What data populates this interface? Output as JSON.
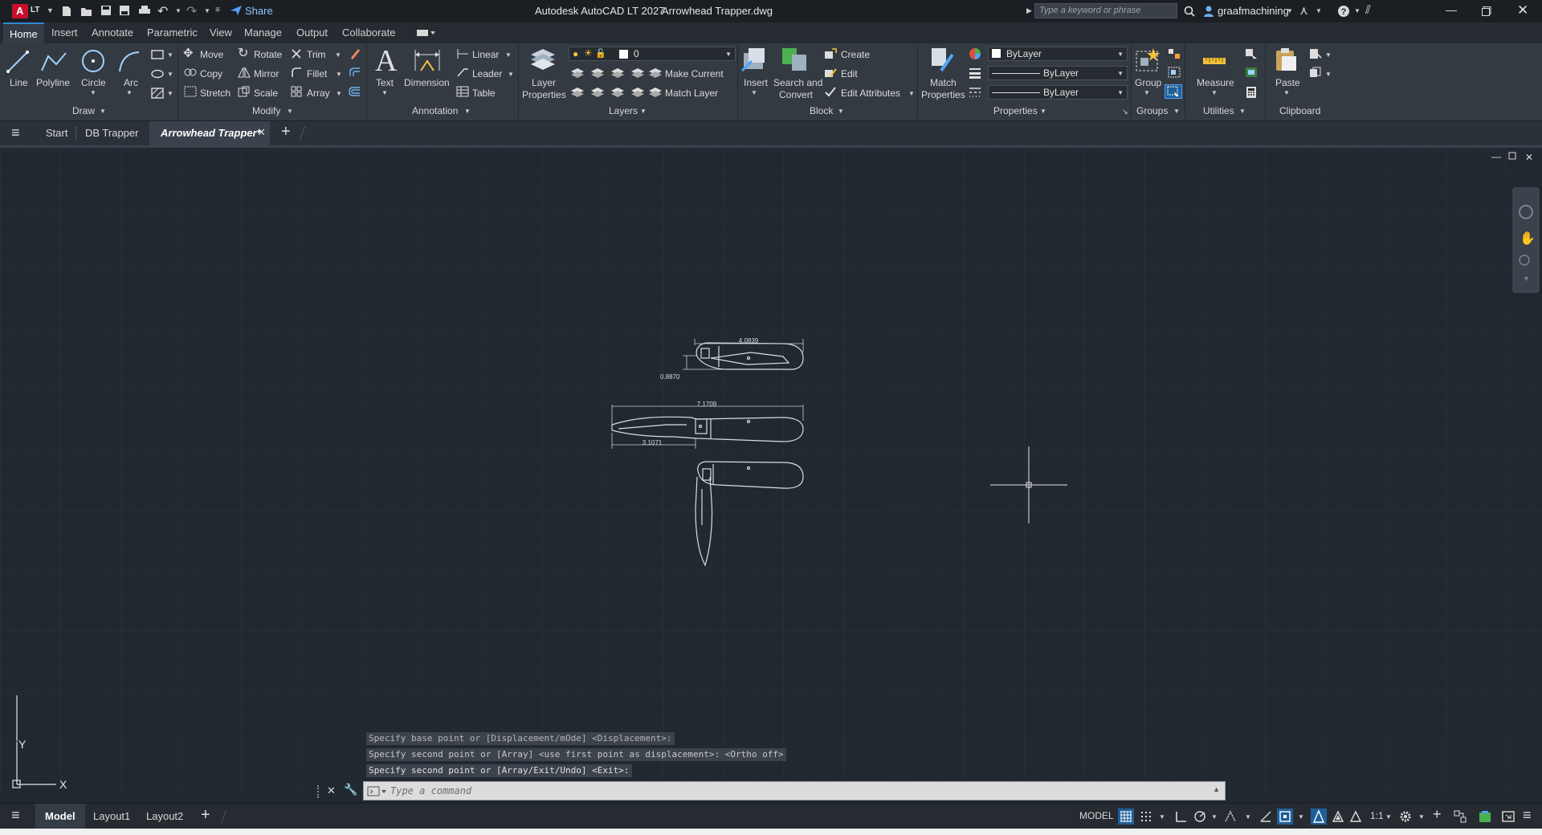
{
  "app": {
    "logo_text": "A",
    "logo_badge": "LT",
    "share_label": "Share",
    "product": "Autodesk AutoCAD LT 2027",
    "filename": "Arrowhead Trapper.dwg",
    "search_placeholder": "Type a keyword or phrase",
    "username": "graafmachining"
  },
  "ribbon_tabs": [
    "Home",
    "Insert",
    "Annotate",
    "Parametric",
    "View",
    "Manage",
    "Output",
    "Collaborate"
  ],
  "draw": {
    "panel": "Draw",
    "line": "Line",
    "polyline": "Polyline",
    "circle": "Circle",
    "arc": "Arc"
  },
  "modify": {
    "panel": "Modify",
    "move": "Move",
    "rotate": "Rotate",
    "trim": "Trim",
    "copy": "Copy",
    "mirror": "Mirror",
    "fillet": "Fillet",
    "stretch": "Stretch",
    "scale": "Scale",
    "array": "Array"
  },
  "annotation": {
    "panel": "Annotation",
    "text": "Text",
    "dimension": "Dimension",
    "linear": "Linear",
    "leader": "Leader",
    "table": "Table"
  },
  "layers": {
    "panel": "Layers",
    "layer_properties_1": "Layer",
    "layer_properties_2": "Properties",
    "current_layer": "0",
    "make_current": "Make Current",
    "match_layer": "Match Layer"
  },
  "block": {
    "panel": "Block",
    "insert": "Insert",
    "search_1": "Search and",
    "search_2": "Convert",
    "create": "Create",
    "edit": "Edit",
    "edit_attributes": "Edit Attributes"
  },
  "properties": {
    "panel": "Properties",
    "match_1": "Match",
    "match_2": "Properties",
    "color": "ByLayer",
    "linetype": "ByLayer",
    "lineweight": "ByLayer"
  },
  "groups": {
    "panel": "Groups",
    "group": "Group"
  },
  "utilities": {
    "panel": "Utilities",
    "measure": "Measure"
  },
  "clipboard": {
    "panel": "Clipboard",
    "paste": "Paste"
  },
  "file_tabs": {
    "start": "Start",
    "db_trapper": "DB Trapper",
    "active": "Arrowhead Trapper*"
  },
  "drawing": {
    "dim_top_width": "4.0839",
    "dim_top_height": "0.8870",
    "dim_mid_overall": "7.1709",
    "dim_mid_blade": "3.1071"
  },
  "ucs": {
    "y": "Y",
    "x": "X"
  },
  "command": {
    "history": [
      "Specify base point or [Displacement/mOde] <Displacement>:",
      "Specify second point or [Array] <use first point as displacement>:  <Ortho off>",
      "Specify second point or [Array/Exit/Undo] <Exit>:"
    ],
    "placeholder": "Type a command"
  },
  "status": {
    "model_tab": "Model",
    "layout1": "Layout1",
    "layout2": "Layout2",
    "model_space": "MODEL",
    "scale": "1:1"
  },
  "colors": {
    "background": "#212830",
    "ribbon": "#343a42",
    "accent": "#2f8ad8",
    "logo_red": "#c8102e"
  }
}
